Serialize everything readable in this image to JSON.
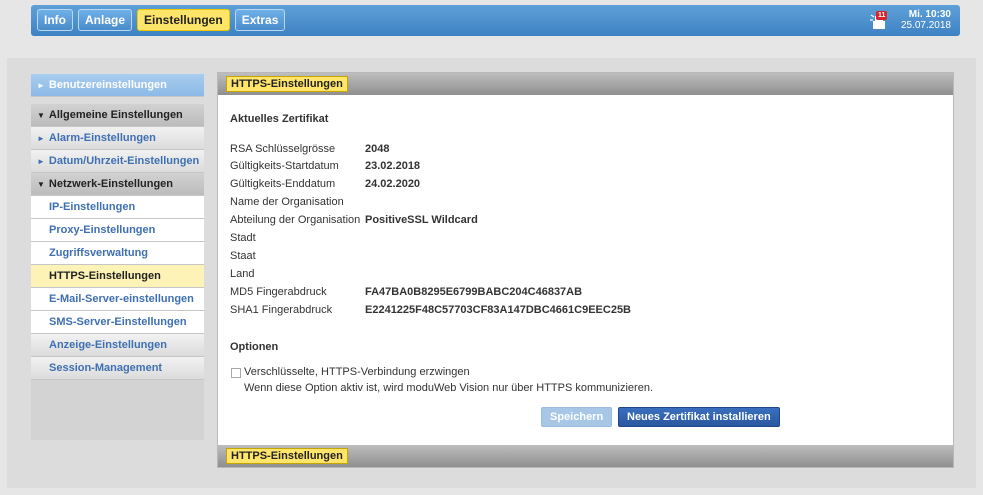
{
  "nav": {
    "items": [
      {
        "label": "Info"
      },
      {
        "label": "Anlage"
      },
      {
        "label": "Einstellungen"
      },
      {
        "label": "Extras"
      }
    ]
  },
  "status": {
    "alarm_count": "11",
    "time": "Mi. 10:30",
    "date": "25.07.2018"
  },
  "sidebar": {
    "user_settings": "Benutzereinstellungen",
    "general_settings": "Allgemeine Einstellungen",
    "alarm": "Alarm-Einstellungen",
    "datetime": "Datum/Uhrzeit-Einstellungen",
    "network": "Netzwerk-Einstellungen",
    "ip": "IP-Einstellungen",
    "proxy": "Proxy-Einstellungen",
    "access": "Zugriffsverwaltung",
    "https": "HTTPS-Einstellungen",
    "mail": "E-Mail-Server-einstellungen",
    "sms": "SMS-Server-Einstellungen",
    "display": "Anzeige-Einstellungen",
    "session": "Session-Management"
  },
  "panel": {
    "tag": "HTTPS-Einstellungen",
    "current_cert": "Aktuelles Zertifikat",
    "rows": [
      {
        "label": "RSA Schlüsselgrösse",
        "value": "2048"
      },
      {
        "label": "Gültigkeits-Startdatum",
        "value": "23.02.2018"
      },
      {
        "label": "Gültigkeits-Enddatum",
        "value": "24.02.2020"
      },
      {
        "label": "Name der Organisation",
        "value": ""
      },
      {
        "label": "Abteilung der Organisation",
        "value": "PositiveSSL Wildcard"
      },
      {
        "label": "Stadt",
        "value": ""
      },
      {
        "label": "Staat",
        "value": ""
      },
      {
        "label": "Land",
        "value": ""
      },
      {
        "label": "MD5 Fingerabdruck",
        "value": "FA47BA0B8295E6799BABC204C46837AB"
      },
      {
        "label": "SHA1 Fingerabdruck",
        "value": "E2241225F48C57703CF83A147DBC4661C9EEC25B"
      }
    ],
    "options_title": "Optionen",
    "force_https_label": "Verschlüsselte, HTTPS-Verbindung erzwingen",
    "force_https_desc": "Wenn diese Option aktiv ist, wird moduWeb Vision nur über HTTPS kommunizieren.",
    "save_button": "Speichern",
    "install_button": "Neues Zertifikat installieren"
  },
  "colors": {
    "accent": "#ffe66a",
    "nav_blue": "#4a8ccb",
    "primary_button": "#2a579f"
  }
}
